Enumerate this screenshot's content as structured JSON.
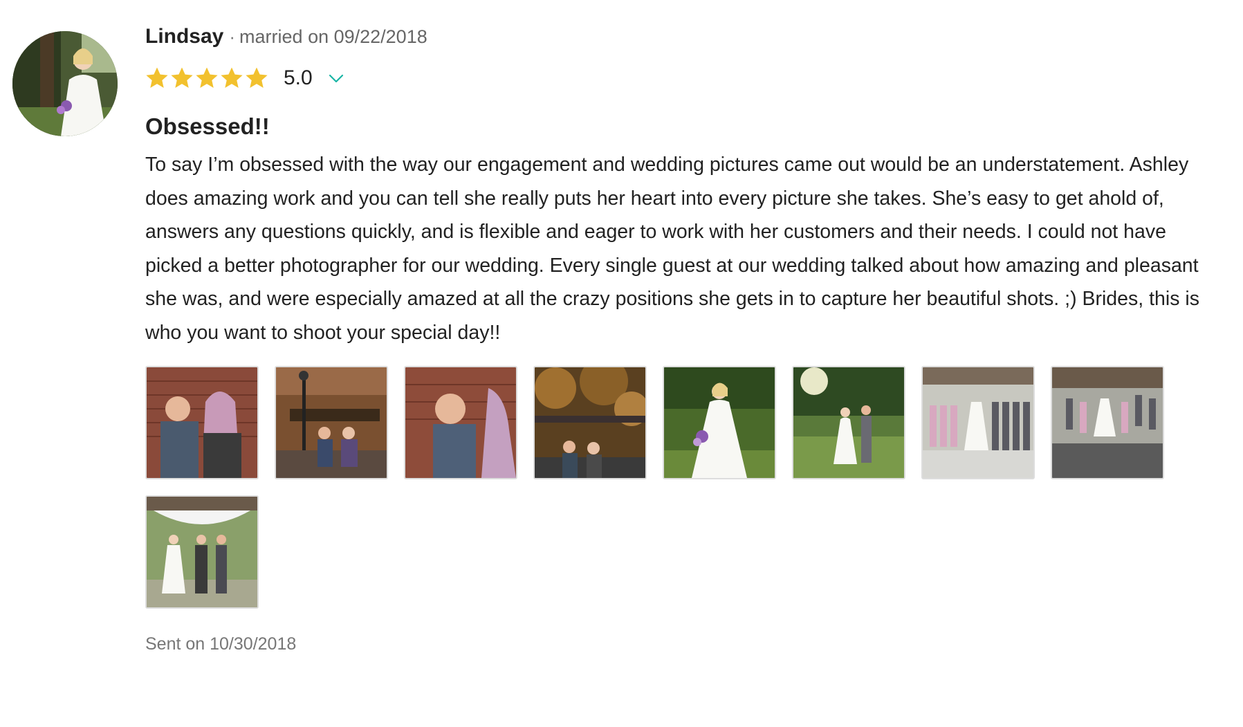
{
  "reviewer": {
    "name": "Lindsay",
    "separator": "·",
    "married_text": "married on 09/22/2018"
  },
  "rating": {
    "stars": 5,
    "max_stars": 5,
    "value_text": "5.0",
    "star_color": "#f2c12e",
    "chevron_color": "#19b5a5"
  },
  "review": {
    "title": "Obsessed!!",
    "body": "To say I’m obsessed with the way our engagement and wedding pictures came out would be an understatement. Ashley does amazing work and you can tell she really puts her heart into every picture she takes. She’s easy to get ahold of, answers any questions quickly, and is flexible and eager to work with her customers and their needs. I could not have picked a better photographer for our wedding. Every single guest at our wedding talked about how amazing and pleasant she was, and were especially amazed at all the crazy positions she gets in to capture her beautiful shots. ;) Brides, this is who you want to shoot your special day!!"
  },
  "photos": [
    {
      "subject": "couple-brick-wall"
    },
    {
      "subject": "couple-street-lamp"
    },
    {
      "subject": "couple-brick-wall-closeup"
    },
    {
      "subject": "couple-autumn-trees"
    },
    {
      "subject": "bride-bouquet"
    },
    {
      "subject": "couple-walking-grass"
    },
    {
      "subject": "wedding-party-lineup"
    },
    {
      "subject": "wedding-party-jumping"
    },
    {
      "subject": "ceremony-gazebo"
    }
  ],
  "footer": {
    "sent_text": "Sent on 10/30/2018"
  }
}
